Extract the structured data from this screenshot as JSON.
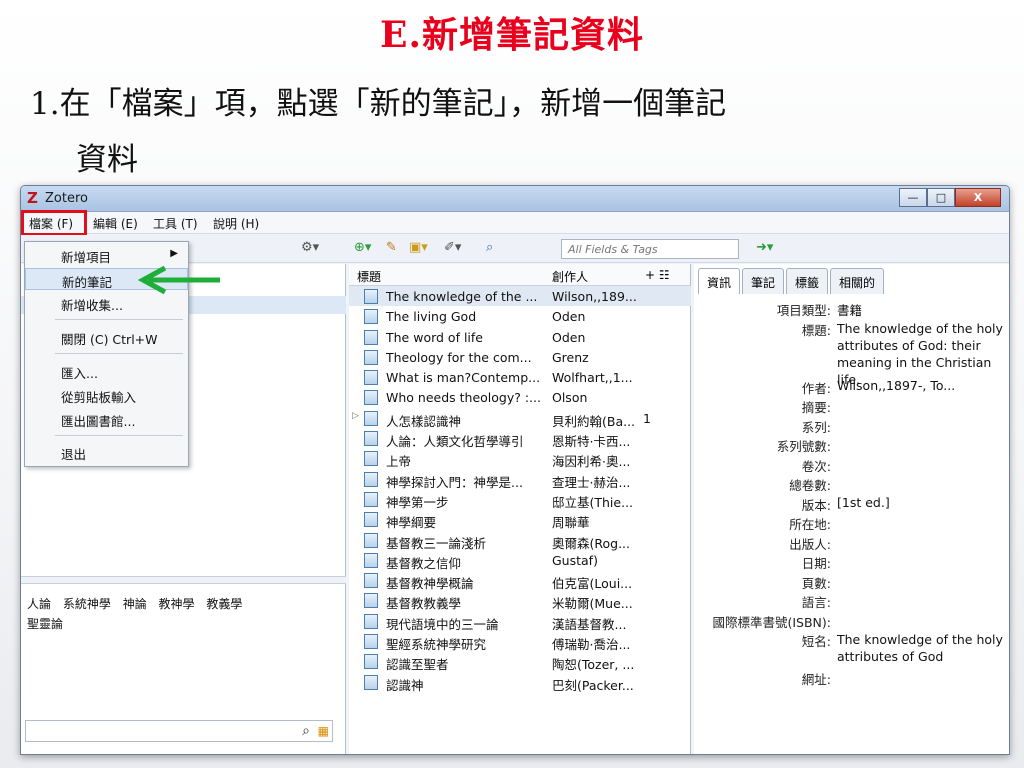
{
  "slide": {
    "title": "E.新增筆記資料",
    "line1": "1.在「檔案」項，點選「新的筆記」，新增一個筆記",
    "line2": "資料"
  },
  "window": {
    "title": "Zotero",
    "logo": "Z",
    "buttons": {
      "minimize": "—",
      "maximize": "□",
      "close": "X"
    }
  },
  "menubar": [
    "檔案 (F)",
    "編輯 (E)",
    "工具 (T)",
    "說明 (H)"
  ],
  "dropdown": {
    "items": [
      "新增項目",
      "新的筆記",
      "新增收集...",
      "關閉 (C)  Ctrl+W",
      "匯入...",
      "從剪貼板輸入",
      "匯出圖書館...",
      "退出"
    ]
  },
  "toolbar": {
    "search_placeholder": "All Fields & Tags"
  },
  "columns": {
    "title": "標題",
    "creator": "創作人"
  },
  "items": [
    {
      "title": "The knowledge of the ...",
      "creator": "Wilson,,189..."
    },
    {
      "title": "The living God",
      "creator": "Oden"
    },
    {
      "title": "The word of life",
      "creator": "Oden"
    },
    {
      "title": "Theology for the com...",
      "creator": "Grenz"
    },
    {
      "title": "What is man?Contemp...",
      "creator": "Wolfhart,,1..."
    },
    {
      "title": "Who needs theology? :...",
      "creator": "Olson"
    },
    {
      "title": "人怎樣認識神",
      "creator": "貝利約翰(Ba...",
      "notes": "1"
    },
    {
      "title": "人論：人類文化哲學導引",
      "creator": "恩斯特·卡西..."
    },
    {
      "title": "上帝",
      "creator": "海因利希·奧..."
    },
    {
      "title": "神學探討入門：神學是...",
      "creator": "查理士·赫治..."
    },
    {
      "title": "神學第一步",
      "creator": "邸立基(Thie..."
    },
    {
      "title": "神學綱要",
      "creator": "周聯華"
    },
    {
      "title": "基督教三一論淺析",
      "creator": "奧爾森(Rog..."
    },
    {
      "title": "基督教之信仰",
      "creator": "Gustaf)"
    },
    {
      "title": "基督教神學概論",
      "creator": "伯克富(Loui..."
    },
    {
      "title": "基督教教義學",
      "creator": "米勒爾(Mue..."
    },
    {
      "title": "現代語境中的三一論",
      "creator": "漢語基督教..."
    },
    {
      "title": "聖經系統神學研究",
      "creator": "傅瑞勒·喬治..."
    },
    {
      "title": "認識至聖者",
      "creator": "陶恕(Tozer, ..."
    },
    {
      "title": "認識神",
      "creator": "巴刻(Packer..."
    }
  ],
  "tags": [
    "人論",
    "系統神學",
    "神論",
    "教神學",
    "教義學",
    "聖靈論"
  ],
  "tabs": [
    "資訊",
    "筆記",
    "標籤",
    "相關的"
  ],
  "info": {
    "type_label": "項目類型:",
    "type_value": "書籍",
    "title_label": "標題:",
    "title_value": "The knowledge of the holy attributes of God: their meaning in the Christian life.",
    "author_label": "作者:",
    "author_value": "Wilson,,1897-, To...",
    "abstract_label": "摘要:",
    "series_label": "系列:",
    "series_no_label": "系列號數:",
    "volume_label": "卷次:",
    "volumes_label": "總卷數:",
    "edition_label": "版本:",
    "edition_value": "[1st ed.]",
    "place_label": "所在地:",
    "publisher_label": "出版人:",
    "date_label": "日期:",
    "pages_label": "頁數:",
    "lang_label": "語言:",
    "isbn_label": "國際標準書號(ISBN):",
    "short_label": "短名:",
    "short_value": "The knowledge of the holy attributes of God",
    "url_label": "網址:"
  },
  "colors": {
    "accent_red": "#e10e1c",
    "arrow_green": "#1fae3a"
  }
}
